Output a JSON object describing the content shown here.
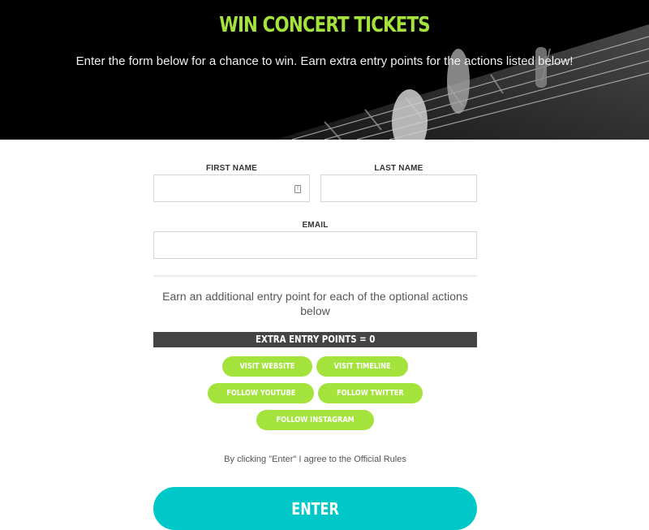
{
  "hero": {
    "title": "WIN CONCERT TICKETS",
    "subtitle": "Enter the form below for a chance to win. Earn extra entry points for the actions listed below!"
  },
  "form": {
    "first_name_label": "FIRST NAME",
    "first_name_value": "",
    "last_name_label": "LAST NAME",
    "last_name_value": "",
    "email_label": "EMAIL",
    "email_value": ""
  },
  "extra": {
    "description": "Earn an additional entry point for each of the optional actions below",
    "points_label": "EXTRA ENTRY POINTS = 0",
    "points": 0,
    "actions": [
      "VISIT WEBSITE",
      "VISIT TIMELINE",
      "FOLLOW YOUTUBE",
      "FOLLOW TWITTER",
      "FOLLOW INSTAGRAM"
    ]
  },
  "footer": {
    "agree_text": "By clicking \"Enter\" I agree to the Official Rules",
    "enter_label": "ENTER"
  },
  "colors": {
    "accent_green": "#a3e33b",
    "enter_teal": "#00c8c8",
    "bar_dark": "#444444"
  }
}
